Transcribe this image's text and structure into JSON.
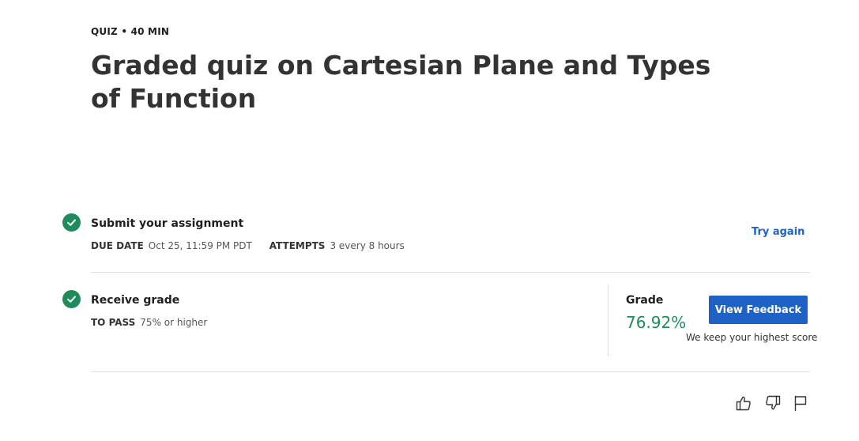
{
  "header": {
    "type": "QUIZ",
    "separator": "•",
    "duration": "40 MIN",
    "title": "Graded quiz on Cartesian Plane and Types of Function"
  },
  "submit": {
    "heading": "Submit your assignment",
    "due_label": "DUE DATE",
    "due_value": "Oct 25, 11:59 PM PDT",
    "attempts_label": "ATTEMPTS",
    "attempts_value": "3 every 8 hours",
    "try_again": "Try again"
  },
  "receive": {
    "heading": "Receive grade",
    "pass_label": "TO PASS",
    "pass_value": "75% or higher"
  },
  "grade": {
    "label": "Grade",
    "value": "76.92%",
    "button": "View Feedback",
    "note": "We keep your highest score"
  },
  "colors": {
    "accent": "#1f62c5",
    "success": "#1e8c5a"
  },
  "icons": [
    "check-icon",
    "thumbs-up-icon",
    "thumbs-down-icon",
    "flag-icon"
  ]
}
